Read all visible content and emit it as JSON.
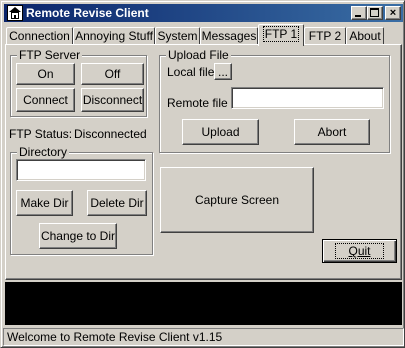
{
  "window": {
    "title": "Remote Revise Client"
  },
  "titlebar_buttons": {
    "minimize": "minimize",
    "maximize": "maximize",
    "close": "×"
  },
  "tabs": [
    {
      "label": "Connection"
    },
    {
      "label": "Annoying Stuff"
    },
    {
      "label": "System"
    },
    {
      "label": "Messages"
    },
    {
      "label": "FTP 1",
      "active": true
    },
    {
      "label": "FTP 2"
    },
    {
      "label": "About"
    }
  ],
  "ftp_server": {
    "group_label": "FTP Server",
    "on_label": "On",
    "off_label": "Off",
    "connect_label": "Connect",
    "disconnect_label": "Disconnect"
  },
  "ftp_status": {
    "label": "FTP Status:",
    "value": "Disconnected"
  },
  "directory": {
    "group_label": "Directory",
    "value": "",
    "make_dir_label": "Make Dir",
    "delete_dir_label": "Delete Dir",
    "change_dir_label": "Change to Dir"
  },
  "upload_file": {
    "group_label": "Upload File",
    "local_file_label": "Local file",
    "browse_label": "...",
    "remote_file_label": "Remote file",
    "remote_file_value": "",
    "upload_label": "Upload",
    "abort_label": "Abort"
  },
  "capture_label": "Capture Screen",
  "quit_label": "Quit",
  "status_bar": {
    "text": "Welcome to Remote Revise Client v1.15"
  },
  "colors": {
    "titlebar_start": "#0a246a",
    "titlebar_end": "#3a6ea5",
    "face": "#d4d0c8",
    "console": "#000000"
  }
}
